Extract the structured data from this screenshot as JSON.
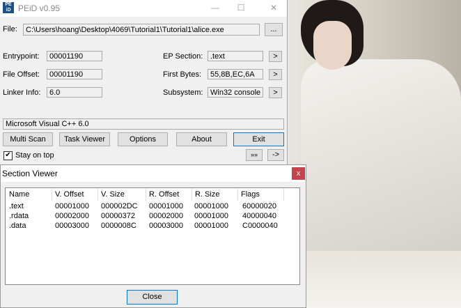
{
  "peid": {
    "title": "PEiD v0.95",
    "icon_text": "PE iD",
    "window_buttons": {
      "minimize": "—",
      "maximize": "☐",
      "close": "✕"
    },
    "file_label": "File:",
    "file_path": "C:\\Users\\hoang\\Desktop\\4069\\Tutorial1\\Tutorial1\\alice.exe",
    "browse_label": "...",
    "entrypoint_label": "Entrypoint:",
    "entrypoint": "00001190",
    "file_offset_label": "File Offset:",
    "file_offset": "00001190",
    "linker_info_label": "Linker Info:",
    "linker_info": "6.0",
    "ep_section_label": "EP Section:",
    "ep_section": ".text",
    "first_bytes_label": "First Bytes:",
    "first_bytes": "55,8B,EC,6A",
    "subsystem_label": "Subsystem:",
    "subsystem": "Win32 console",
    "arrow_label": ">",
    "detection": "Microsoft Visual C++ 6.0",
    "buttons": {
      "multi_scan": "Multi Scan",
      "task_viewer": "Task Viewer",
      "options": "Options",
      "about": "About",
      "exit": "Exit",
      "extra": "»»",
      "more": "->"
    },
    "stay_on_top": "Stay on top",
    "stay_on_top_checked": "✔"
  },
  "section_viewer": {
    "title": "Section Viewer",
    "close_x": "x",
    "columns": [
      "Name",
      "V. Offset",
      "V. Size",
      "R. Offset",
      "R. Size",
      "Flags"
    ],
    "rows": [
      [
        ".text",
        "00001000",
        "000002DC",
        "00001000",
        "00001000",
        "60000020"
      ],
      [
        ".rdata",
        "00002000",
        "00000372",
        "00002000",
        "00001000",
        "40000040"
      ],
      [
        ".data",
        "00003000",
        "0000008C",
        "00003000",
        "00001000",
        "C0000040"
      ]
    ],
    "close_button": "Close"
  }
}
